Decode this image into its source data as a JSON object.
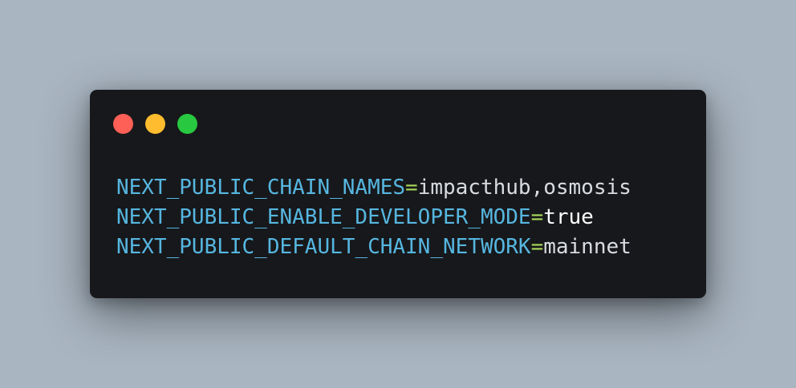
{
  "window": {
    "controls": [
      {
        "name": "close",
        "color": "#fe5f57"
      },
      {
        "name": "minimize",
        "color": "#febc2e"
      },
      {
        "name": "maximize",
        "color": "#28c840"
      }
    ]
  },
  "code": {
    "lines": [
      {
        "key": "NEXT_PUBLIC_CHAIN_NAMES",
        "eq": "=",
        "value": "impacthub,osmosis"
      },
      {
        "key": "NEXT_PUBLIC_ENABLE_DEVELOPER_MODE",
        "eq": "=",
        "value": "true"
      },
      {
        "key": "NEXT_PUBLIC_DEFAULT_CHAIN_NETWORK",
        "eq": "=",
        "value": "mainnet"
      }
    ]
  },
  "colors": {
    "background": "#a9b5c1",
    "window": "#17181b",
    "key": "#56b6e0",
    "equals": "#a8d85a",
    "value": "#d8dce1"
  }
}
